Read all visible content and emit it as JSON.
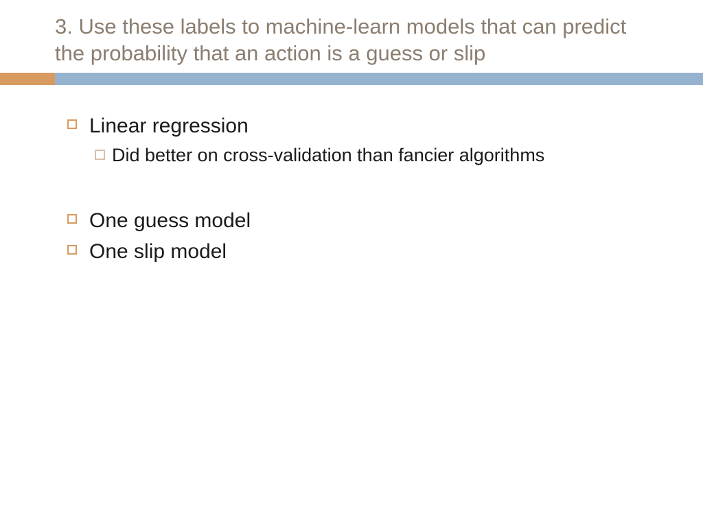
{
  "title": "3. Use these labels to machine-learn models that can predict the probability that an action is a guess or slip",
  "bullets": {
    "item1": "Linear regression",
    "sub1": "Did better on cross-validation than fancier algorithms",
    "item2": "One guess model",
    "item3": "One slip model"
  }
}
